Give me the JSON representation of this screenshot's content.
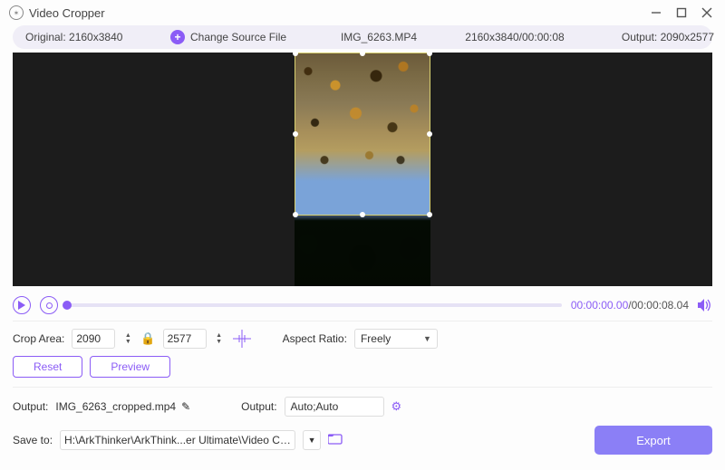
{
  "titlebar": {
    "app_name": "Video Cropper"
  },
  "infobar": {
    "original_label": "Original:",
    "original_dims": "2160x3840",
    "change_source": "Change Source File",
    "filename": "IMG_6263.MP4",
    "source_info": "2160x3840/00:00:08",
    "output_label": "Output:",
    "output_dims": "2090x2577"
  },
  "timeline": {
    "current": "00:00:00.00",
    "separator": "/",
    "total": "00:00:08.04"
  },
  "crop": {
    "label": "Crop Area:",
    "width": "2090",
    "height": "2577",
    "aspect_label": "Aspect Ratio:",
    "aspect_value": "Freely"
  },
  "buttons": {
    "reset": "Reset",
    "preview": "Preview",
    "export": "Export"
  },
  "output": {
    "label": "Output:",
    "filename": "IMG_6263_cropped.mp4",
    "format_label": "Output:",
    "format_value": "Auto;Auto"
  },
  "save": {
    "label": "Save to:",
    "path": "H:\\ArkThinker\\ArkThink...er Ultimate\\Video Crop"
  }
}
